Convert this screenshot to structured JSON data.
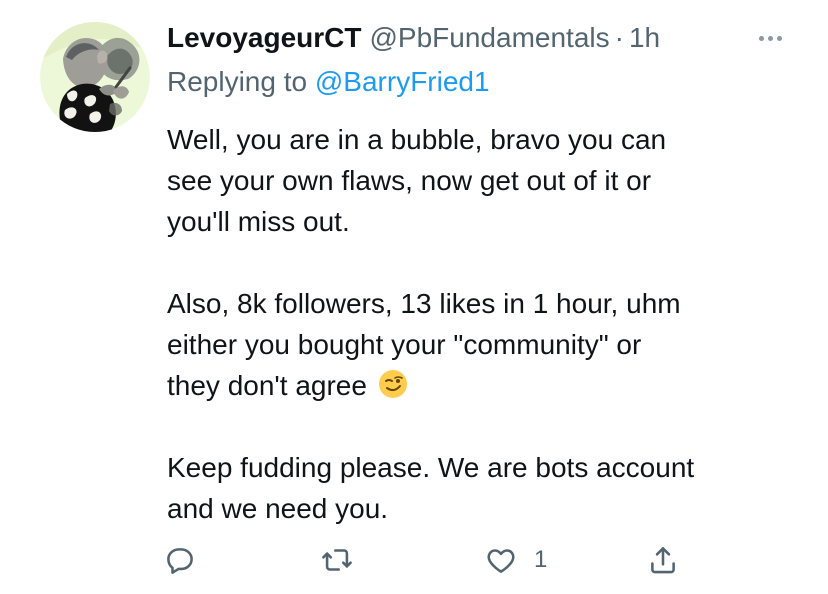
{
  "tweet": {
    "display_name": "LevoyageurCT",
    "handle": "@PbFundamentals",
    "separator": "·",
    "time": "1h",
    "replying_prefix": "Replying to ",
    "replying_to": "@BarryFried1",
    "paragraphs": [
      {
        "lines": [
          "Well, you are in a bubble, bravo you can",
          "see your own flaws, now get out of it or",
          "you'll miss out."
        ]
      },
      {
        "lines": [
          "Also, 8k followers, 13 likes in 1 hour, uhm",
          "either you bought your \"community\" or",
          "they don't agree"
        ],
        "trailing_emoji": "winking-face-emoji"
      },
      {
        "lines": [
          "Keep fudding please. We are bots account",
          "and we need you."
        ]
      }
    ]
  },
  "actions": {
    "reply_icon": "reply-icon",
    "retweet_icon": "retweet-icon",
    "like_icon": "heart-icon",
    "like_count": "1",
    "share_icon": "share-icon"
  },
  "colors": {
    "text": "#0f1419",
    "secondary": "#536471",
    "link": "#1d9bf0",
    "background": "#ffffff"
  }
}
